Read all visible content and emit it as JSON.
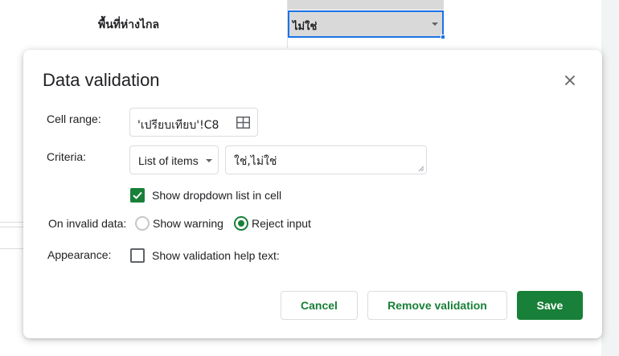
{
  "sheet": {
    "row_label": "พื้นที่ห่างไกล",
    "cell_value": "ไม่ใช่"
  },
  "dialog": {
    "title": "Data validation",
    "cell_range": {
      "label": "Cell range:",
      "value": "'เปรียบเทียบ'!C8"
    },
    "criteria": {
      "label": "Criteria:",
      "type_selected": "List of items",
      "items_value": "ใช่,ไม่ใช่"
    },
    "show_dropdown": {
      "label": "Show dropdown list in cell",
      "checked": true
    },
    "invalid_data": {
      "label": "On invalid data:",
      "options": [
        "Show warning",
        "Reject input"
      ],
      "selected": "Reject input"
    },
    "appearance": {
      "label": "Appearance:",
      "help_text_label": "Show validation help text:",
      "checked": false
    },
    "buttons": {
      "cancel": "Cancel",
      "remove": "Remove validation",
      "save": "Save"
    }
  },
  "colors": {
    "accent_green": "#188038",
    "selection_blue": "#1a73e8"
  },
  "icons": [
    "close-icon",
    "grid-select-icon",
    "checkmark-icon",
    "chevron-down-icon",
    "resize-grip-icon"
  ]
}
